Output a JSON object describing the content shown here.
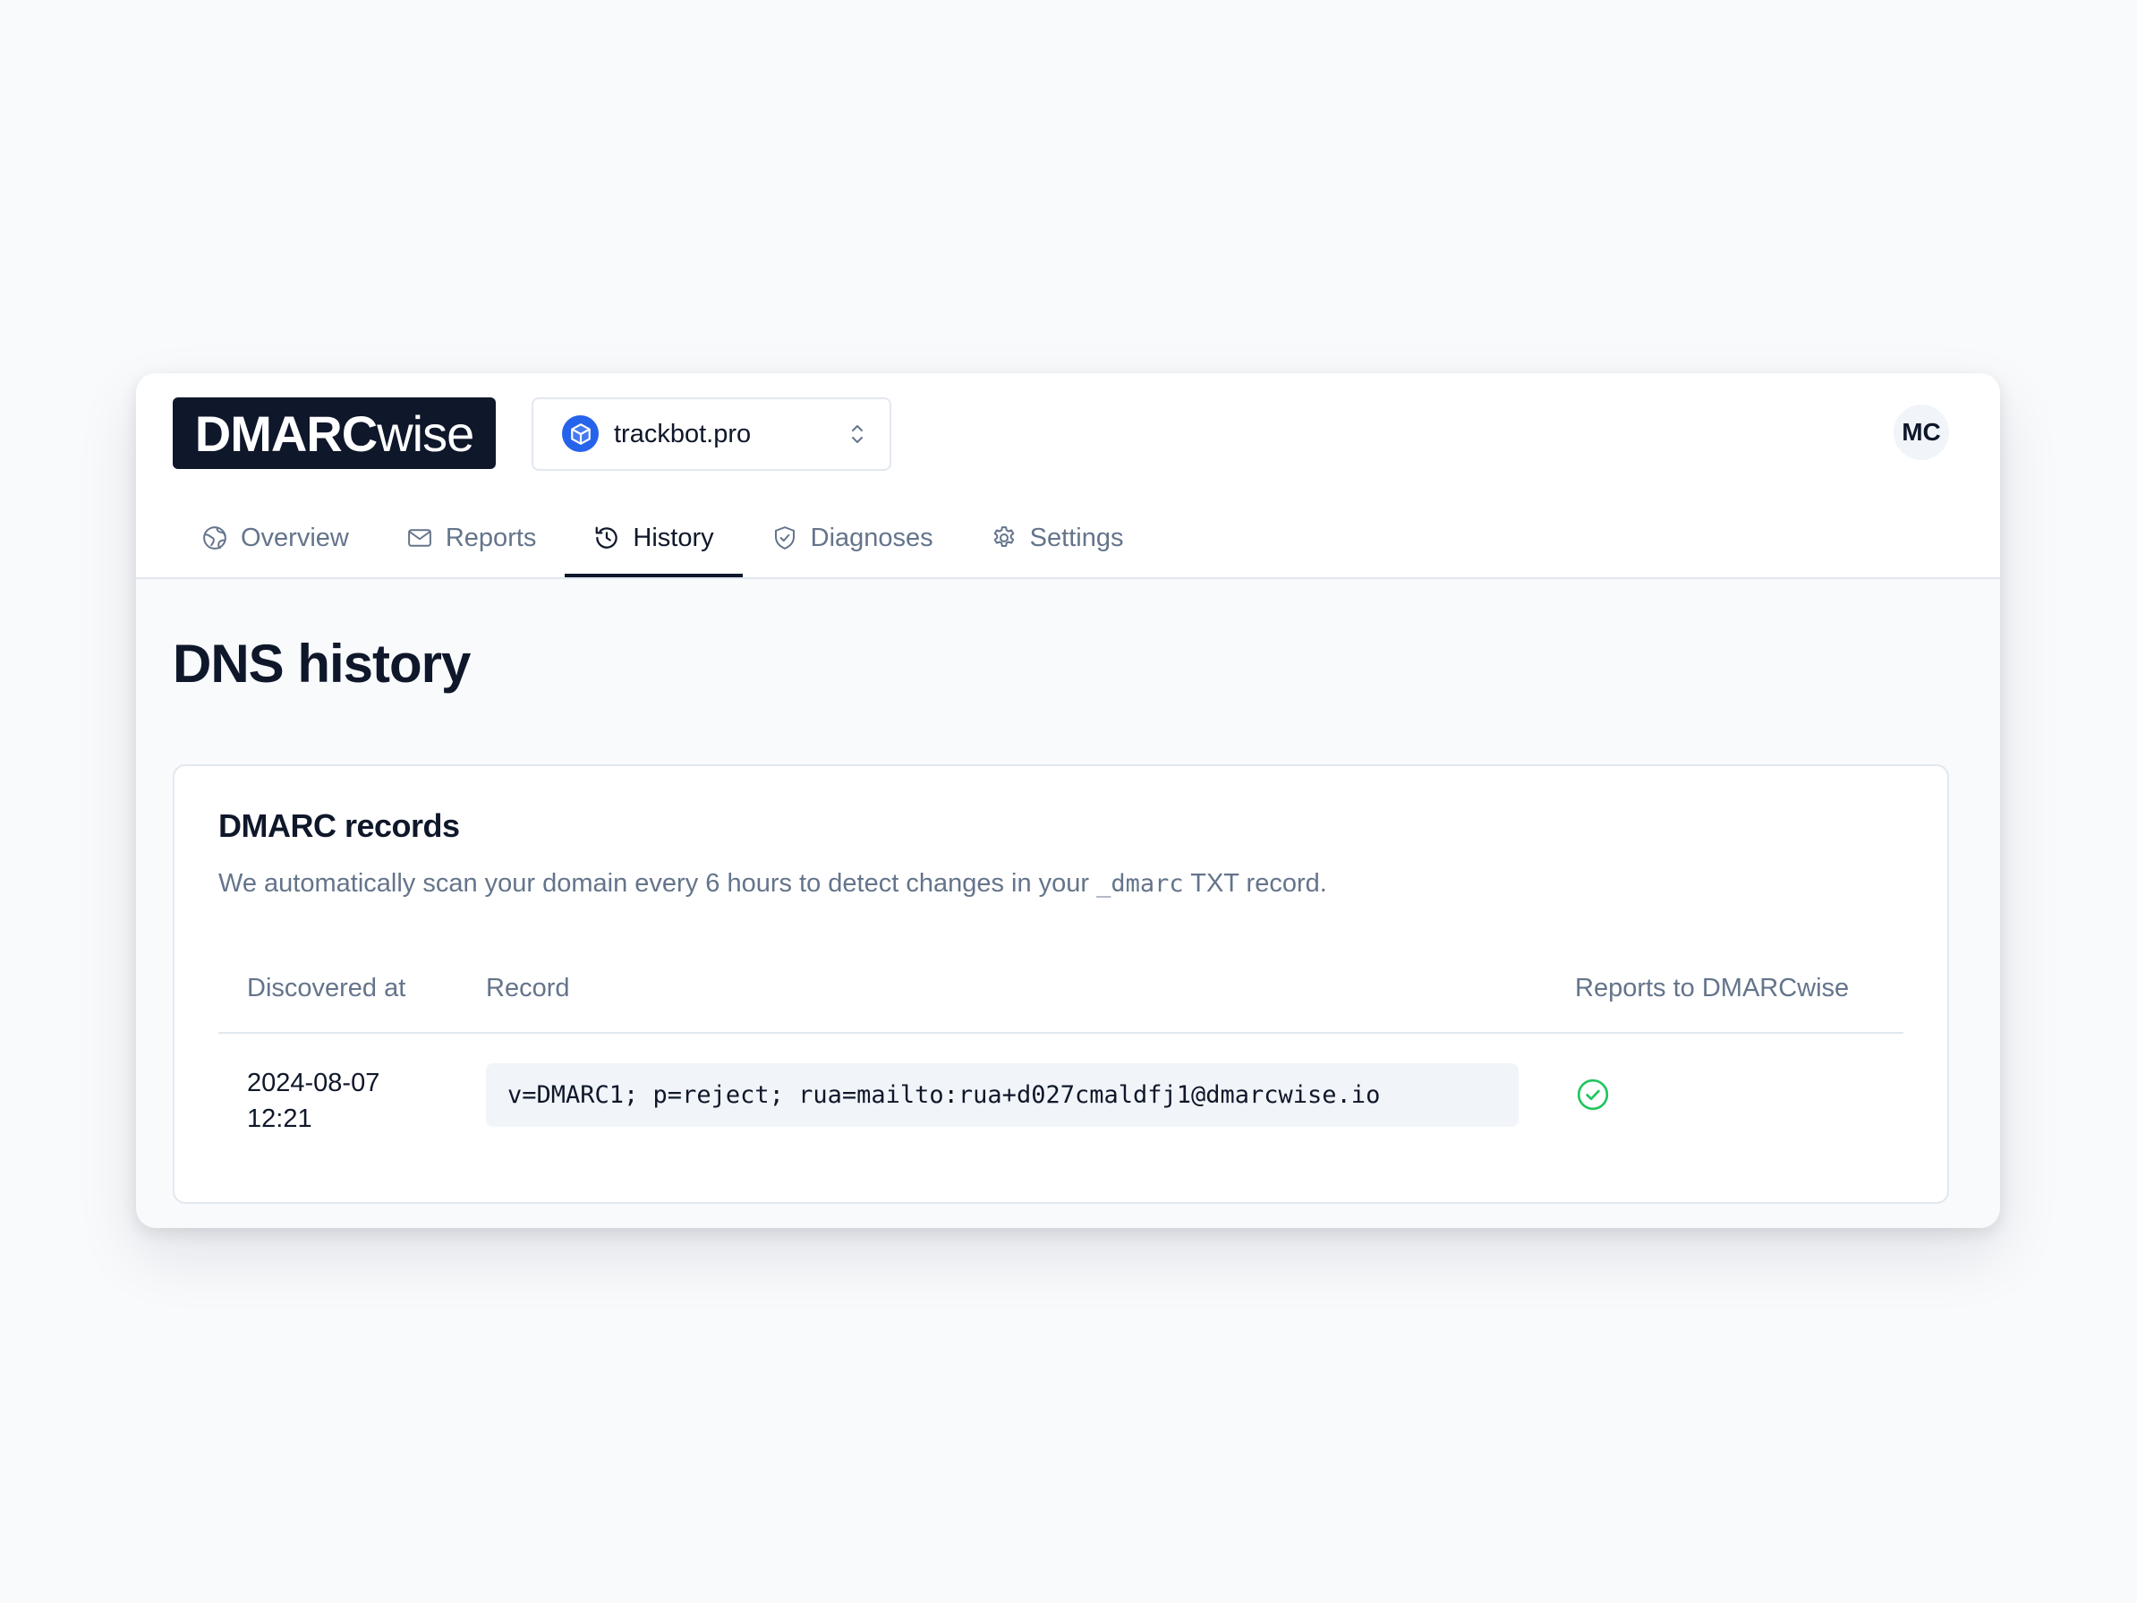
{
  "logo": {
    "bold": "DMARC",
    "light": "wise"
  },
  "domain_selector": {
    "value": "trackbot.pro",
    "icon": "cube-icon"
  },
  "user": {
    "initials": "MC"
  },
  "tabs": [
    {
      "label": "Overview",
      "icon": "globe-icon",
      "active": false
    },
    {
      "label": "Reports",
      "icon": "mail-icon",
      "active": false
    },
    {
      "label": "History",
      "icon": "history-icon",
      "active": true
    },
    {
      "label": "Diagnoses",
      "icon": "shield-check-icon",
      "active": false
    },
    {
      "label": "Settings",
      "icon": "gear-icon",
      "active": false
    }
  ],
  "page": {
    "title": "DNS history"
  },
  "card": {
    "title": "DMARC records",
    "desc_before": "We automatically scan your domain every 6 hours to detect changes in your ",
    "desc_code": "_dmarc",
    "desc_after": " TXT record."
  },
  "table": {
    "headers": [
      "Discovered at",
      "Record",
      "Reports to DMARCwise"
    ],
    "rows": [
      {
        "date": "2024-08-07",
        "time": "12:21",
        "record": "v=DMARC1; p=reject; rua=mailto:rua+d027cmaldfj1@dmarcwise.io",
        "reports_to_dmarcwise": true,
        "status_icon": "check-circle-icon"
      }
    ]
  },
  "colors": {
    "brand_dark": "#0f172a",
    "accent_blue": "#2563eb",
    "success_green": "#22c55e",
    "muted_text": "#64748b"
  }
}
